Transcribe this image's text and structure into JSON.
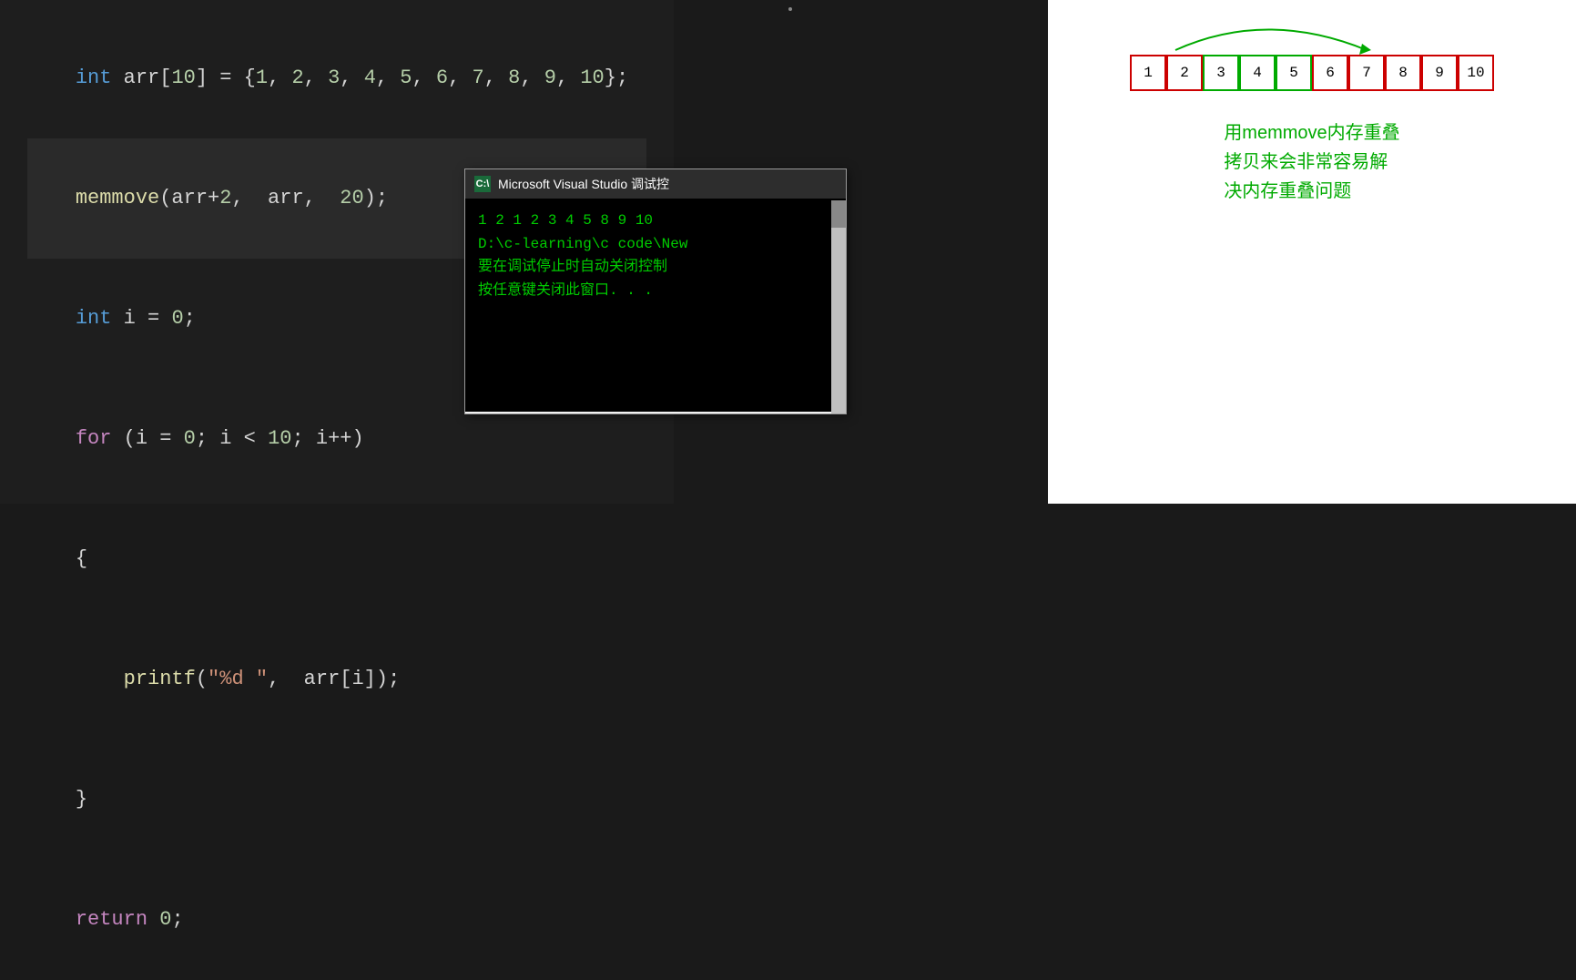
{
  "code": {
    "lines": [
      {
        "id": "line1",
        "content": "int arr[10] = {1, 2, 3, 4, 5, 6, 7, 8, 9, 10};",
        "highlighted": false
      },
      {
        "id": "line2",
        "content": "memmove(arr+2, arr, 20);",
        "highlighted": true
      },
      {
        "id": "line3",
        "content": "int i = 0;",
        "highlighted": false
      },
      {
        "id": "line4",
        "content": "for (i = 0; i < 10; i++)",
        "highlighted": false
      },
      {
        "id": "line5",
        "content": "{",
        "highlighted": false
      },
      {
        "id": "line6",
        "content": "    printf(\"%d \", arr[i]);",
        "highlighted": false
      },
      {
        "id": "line7",
        "content": "}",
        "highlighted": false
      },
      {
        "id": "line8",
        "content": "return 0;",
        "highlighted": false
      }
    ]
  },
  "debug": {
    "title": "Microsoft Visual Studio 调试控",
    "icon_label": "C:\\",
    "output_line1": "1 2 1 2 3 4 5 8 9 10",
    "output_line2": "D:\\c-learning\\c code\\New",
    "output_line3": "要在调试停止时自动关闭控制",
    "output_line4": "按任意键关闭此窗口. . ."
  },
  "diagram": {
    "cells": [
      {
        "value": "1",
        "type": "red"
      },
      {
        "value": "2",
        "type": "red"
      },
      {
        "value": "3",
        "type": "green"
      },
      {
        "value": "4",
        "type": "green"
      },
      {
        "value": "5",
        "type": "green"
      },
      {
        "value": "6",
        "type": "red"
      },
      {
        "value": "7",
        "type": "red"
      },
      {
        "value": "8",
        "type": "red"
      },
      {
        "value": "9",
        "type": "red"
      },
      {
        "value": "10",
        "type": "red"
      }
    ],
    "description_line1": "用memmove内存重叠",
    "description_line2": "拷贝来会非常容易解",
    "description_line3": "决内存重叠问题"
  }
}
